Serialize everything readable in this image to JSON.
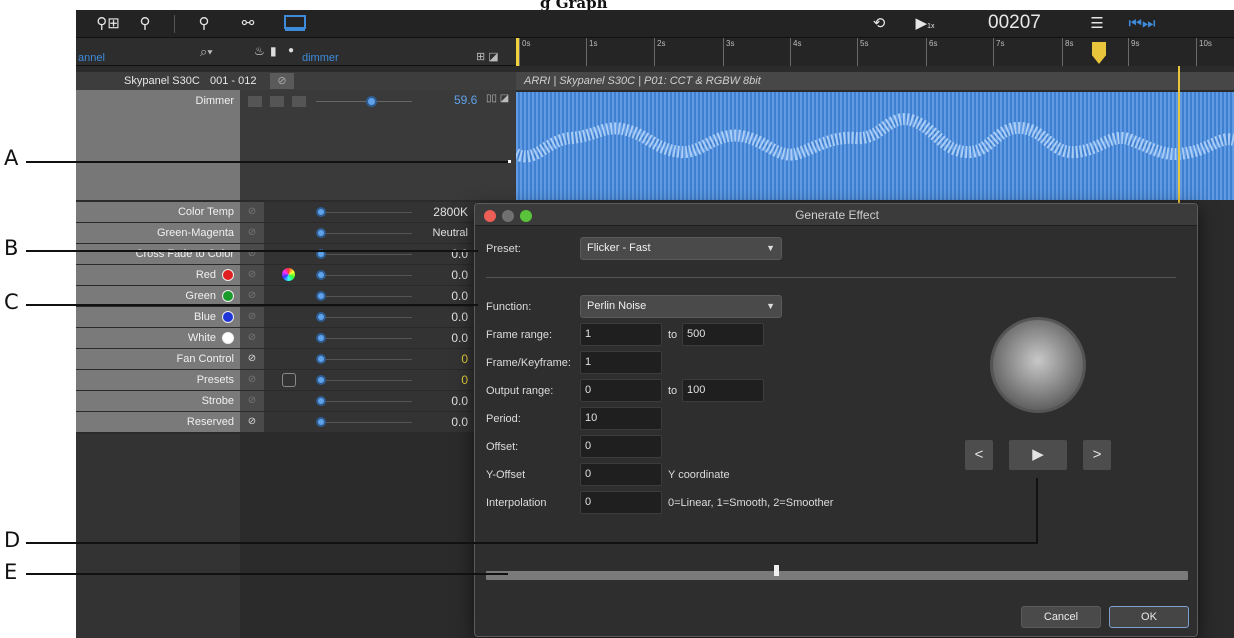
{
  "caption": "g Graph",
  "toolbar": {
    "counter": "00207",
    "counter_sub": "1x"
  },
  "channel_search": {
    "label": "annel",
    "filter_label": "dimmer"
  },
  "ruler": {
    "ticks": [
      "0s",
      "1s",
      "2s",
      "3s",
      "4s",
      "5s",
      "6s",
      "7s",
      "8s",
      "9s",
      "10s"
    ]
  },
  "fixture": {
    "name": "Skypanel S30C",
    "range": "001 - 012",
    "description": "ARRI  |  Skypanel S30C  |  P01: CCT & RGBW 8bit"
  },
  "dimmer": {
    "label": "Dimmer",
    "value": "59.6"
  },
  "channels": [
    {
      "label": "Color Temp",
      "value": "2800K"
    },
    {
      "label": "Green-Magenta",
      "value": "Neutral"
    },
    {
      "label": "Cross Fade to Color",
      "value": "0.0"
    },
    {
      "label": "Red",
      "value": "0.0",
      "swatch": "#e02020"
    },
    {
      "label": "Green",
      "value": "0.0",
      "swatch": "#1a9a2a"
    },
    {
      "label": "Blue",
      "value": "0.0",
      "swatch": "#1f35d8"
    },
    {
      "label": "White",
      "value": "0.0",
      "swatch": "#ffffff"
    },
    {
      "label": "Fan Control",
      "value": "0"
    },
    {
      "label": "Presets",
      "value": "0"
    },
    {
      "label": "Strobe",
      "value": "0.0"
    },
    {
      "label": "Reserved",
      "value": "0.0"
    }
  ],
  "dialog": {
    "title": "Generate Effect",
    "preset_label": "Preset:",
    "preset_value": "Flicker - Fast",
    "function_label": "Function:",
    "function_value": "Perlin Noise",
    "frame_range_label": "Frame range:",
    "frame_range_from": "1",
    "frame_range_to": "500",
    "to_label": "to",
    "frame_per_key_label": "Frame/Keyframe:",
    "frame_per_key_value": "1",
    "output_range_label": "Output range:",
    "output_range_from": "0",
    "output_range_to": "100",
    "period_label": "Period:",
    "period_value": "10",
    "offset_label": "Offset:",
    "offset_value": "0",
    "y_offset_label": "Y-Offset",
    "y_offset_value": "0",
    "y_offset_note": "Y coordinate",
    "interpolation_label": "Interpolation",
    "interpolation_value": "0",
    "interpolation_note": "0=Linear, 1=Smooth, 2=Smoother",
    "prev_glyph": "<",
    "play_glyph": "▶",
    "next_glyph": ">",
    "timeline_position": 0.41,
    "cancel_label": "Cancel",
    "ok_label": "OK"
  },
  "annotations": [
    "A",
    "B",
    "C",
    "D",
    "E"
  ],
  "colors": {
    "accent": "#5fa2ea",
    "playhead": "#e8c53a",
    "waveform": "#3f7fcf"
  }
}
